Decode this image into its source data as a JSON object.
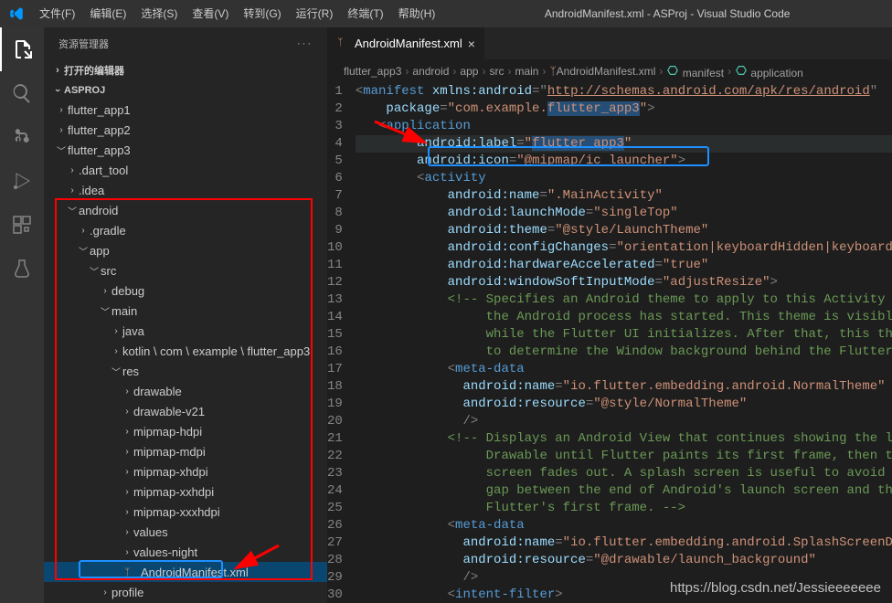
{
  "window_title": "AndroidManifest.xml - ASProj - Visual Studio Code",
  "menu": [
    "文件(F)",
    "编辑(E)",
    "选择(S)",
    "查看(V)",
    "转到(G)",
    "运行(R)",
    "终端(T)",
    "帮助(H)"
  ],
  "sidebar": {
    "title": "资源管理器",
    "sections": {
      "open_editors": "打开的编辑器",
      "project": "ASPROJ"
    },
    "tree": [
      {
        "d": 1,
        "k": "folder-c",
        "label": "flutter_app1"
      },
      {
        "d": 1,
        "k": "folder-c",
        "label": "flutter_app2"
      },
      {
        "d": 1,
        "k": "folder-o",
        "label": "flutter_app3"
      },
      {
        "d": 2,
        "k": "folder-c",
        "label": ".dart_tool"
      },
      {
        "d": 2,
        "k": "folder-c",
        "label": ".idea"
      },
      {
        "d": 2,
        "k": "folder-o",
        "label": "android"
      },
      {
        "d": 3,
        "k": "folder-c",
        "label": ".gradle"
      },
      {
        "d": 3,
        "k": "folder-o",
        "label": "app"
      },
      {
        "d": 4,
        "k": "folder-o",
        "label": "src"
      },
      {
        "d": 5,
        "k": "folder-c",
        "label": "debug"
      },
      {
        "d": 5,
        "k": "folder-o",
        "label": "main"
      },
      {
        "d": 6,
        "k": "folder-c",
        "label": "java"
      },
      {
        "d": 6,
        "k": "folder-c",
        "label": "kotlin \\ com \\ example \\ flutter_app3"
      },
      {
        "d": 6,
        "k": "folder-o",
        "label": "res"
      },
      {
        "d": 7,
        "k": "folder-c",
        "label": "drawable"
      },
      {
        "d": 7,
        "k": "folder-c",
        "label": "drawable-v21"
      },
      {
        "d": 7,
        "k": "folder-c",
        "label": "mipmap-hdpi"
      },
      {
        "d": 7,
        "k": "folder-c",
        "label": "mipmap-mdpi"
      },
      {
        "d": 7,
        "k": "folder-c",
        "label": "mipmap-xhdpi"
      },
      {
        "d": 7,
        "k": "folder-c",
        "label": "mipmap-xxhdpi"
      },
      {
        "d": 7,
        "k": "folder-c",
        "label": "mipmap-xxxhdpi"
      },
      {
        "d": 7,
        "k": "folder-c",
        "label": "values"
      },
      {
        "d": 7,
        "k": "folder-c",
        "label": "values-night"
      },
      {
        "d": 6,
        "k": "file-xml",
        "label": "AndroidManifest.xml",
        "selected": true
      },
      {
        "d": 5,
        "k": "folder-c",
        "label": "profile"
      }
    ]
  },
  "tab": {
    "label": "AndroidManifest.xml"
  },
  "breadcrumbs": [
    "flutter_app3",
    "android",
    "app",
    "src",
    "main",
    "AndroidManifest.xml",
    "manifest",
    "application"
  ],
  "code": {
    "lines": [
      {
        "n": 1,
        "seg": [
          [
            "p",
            "<"
          ],
          [
            "t",
            "manifest"
          ],
          [
            "p",
            " "
          ],
          [
            "a",
            "xmlns:android"
          ],
          [
            "p",
            "="
          ],
          [
            "p",
            "\""
          ],
          [
            "u",
            "http://schemas.android.com/apk/res/android"
          ],
          [
            "p",
            "\""
          ]
        ]
      },
      {
        "n": 2,
        "seg": [
          [
            "sp",
            "    "
          ],
          [
            "a",
            "package"
          ],
          [
            "p",
            "="
          ],
          [
            "s",
            "\"com.example."
          ],
          [
            "ssel",
            "flutter_app3"
          ],
          [
            "s",
            "\""
          ],
          [
            "p",
            ">"
          ]
        ]
      },
      {
        "n": 3,
        "seg": [
          [
            "sp",
            "   "
          ],
          [
            "p",
            "<"
          ],
          [
            "t",
            "application"
          ]
        ]
      },
      {
        "n": 4,
        "seg": [
          [
            "sp",
            "        "
          ],
          [
            "a",
            "android:label"
          ],
          [
            "p",
            "="
          ],
          [
            "s",
            "\""
          ],
          [
            "ssel",
            "flutter_app3"
          ],
          [
            "s",
            "\""
          ]
        ],
        "hl": true
      },
      {
        "n": 5,
        "seg": [
          [
            "sp",
            "        "
          ],
          [
            "a",
            "android:icon"
          ],
          [
            "p",
            "="
          ],
          [
            "s",
            "\"@mipmap/ic_launcher\""
          ],
          [
            "p",
            ">"
          ]
        ]
      },
      {
        "n": 6,
        "seg": [
          [
            "sp",
            "        "
          ],
          [
            "p",
            "<"
          ],
          [
            "t",
            "activity"
          ]
        ]
      },
      {
        "n": 7,
        "seg": [
          [
            "sp",
            "            "
          ],
          [
            "a",
            "android:name"
          ],
          [
            "p",
            "="
          ],
          [
            "s",
            "\".MainActivity\""
          ]
        ]
      },
      {
        "n": 8,
        "seg": [
          [
            "sp",
            "            "
          ],
          [
            "a",
            "android:launchMode"
          ],
          [
            "p",
            "="
          ],
          [
            "s",
            "\"singleTop\""
          ]
        ]
      },
      {
        "n": 9,
        "seg": [
          [
            "sp",
            "            "
          ],
          [
            "a",
            "android:theme"
          ],
          [
            "p",
            "="
          ],
          [
            "s",
            "\"@style/LaunchTheme\""
          ]
        ]
      },
      {
        "n": 10,
        "seg": [
          [
            "sp",
            "            "
          ],
          [
            "a",
            "android:configChanges"
          ],
          [
            "p",
            "="
          ],
          [
            "s",
            "\"orientation|keyboardHidden|keyboard|sc"
          ]
        ]
      },
      {
        "n": 11,
        "seg": [
          [
            "sp",
            "            "
          ],
          [
            "a",
            "android:hardwareAccelerated"
          ],
          [
            "p",
            "="
          ],
          [
            "s",
            "\"true\""
          ]
        ]
      },
      {
        "n": 12,
        "seg": [
          [
            "sp",
            "            "
          ],
          [
            "a",
            "android:windowSoftInputMode"
          ],
          [
            "p",
            "="
          ],
          [
            "s",
            "\"adjustResize\""
          ],
          [
            "p",
            ">"
          ]
        ]
      },
      {
        "n": 13,
        "seg": [
          [
            "sp",
            "            "
          ],
          [
            "c",
            "<!-- Specifies an Android theme to apply to this Activity as "
          ]
        ]
      },
      {
        "n": 14,
        "seg": [
          [
            "sp",
            "                 "
          ],
          [
            "c",
            "the Android process has started. This theme is visible t"
          ]
        ]
      },
      {
        "n": 15,
        "seg": [
          [
            "sp",
            "                 "
          ],
          [
            "c",
            "while the Flutter UI initializes. After that, this theme"
          ]
        ]
      },
      {
        "n": 16,
        "seg": [
          [
            "sp",
            "                 "
          ],
          [
            "c",
            "to determine the Window background behind the Flutter UI"
          ]
        ]
      },
      {
        "n": 17,
        "seg": [
          [
            "sp",
            "            "
          ],
          [
            "p",
            "<"
          ],
          [
            "t",
            "meta-data"
          ]
        ]
      },
      {
        "n": 18,
        "seg": [
          [
            "sp",
            "              "
          ],
          [
            "a",
            "android:name"
          ],
          [
            "p",
            "="
          ],
          [
            "s",
            "\"io.flutter.embedding.android.NormalTheme\""
          ]
        ]
      },
      {
        "n": 19,
        "seg": [
          [
            "sp",
            "              "
          ],
          [
            "a",
            "android:resource"
          ],
          [
            "p",
            "="
          ],
          [
            "s",
            "\"@style/NormalTheme\""
          ]
        ]
      },
      {
        "n": 20,
        "seg": [
          [
            "sp",
            "              "
          ],
          [
            "p",
            "/>"
          ]
        ]
      },
      {
        "n": 21,
        "seg": [
          [
            "sp",
            "            "
          ],
          [
            "c",
            "<!-- Displays an Android View that continues showing the laur"
          ]
        ]
      },
      {
        "n": 22,
        "seg": [
          [
            "sp",
            "                 "
          ],
          [
            "c",
            "Drawable until Flutter paints its first frame, then this"
          ]
        ]
      },
      {
        "n": 23,
        "seg": [
          [
            "sp",
            "                 "
          ],
          [
            "c",
            "screen fades out. A splash screen is useful to avoid any"
          ]
        ]
      },
      {
        "n": 24,
        "seg": [
          [
            "sp",
            "                 "
          ],
          [
            "c",
            "gap between the end of Android's launch screen and the p"
          ]
        ]
      },
      {
        "n": 25,
        "seg": [
          [
            "sp",
            "                 "
          ],
          [
            "c",
            "Flutter's first frame. -->"
          ]
        ]
      },
      {
        "n": 26,
        "seg": [
          [
            "sp",
            "            "
          ],
          [
            "p",
            "<"
          ],
          [
            "t",
            "meta-data"
          ]
        ]
      },
      {
        "n": 27,
        "seg": [
          [
            "sp",
            "              "
          ],
          [
            "a",
            "android:name"
          ],
          [
            "p",
            "="
          ],
          [
            "s",
            "\"io.flutter.embedding.android.SplashScreenDraw"
          ]
        ]
      },
      {
        "n": 28,
        "seg": [
          [
            "sp",
            "              "
          ],
          [
            "a",
            "android:resource"
          ],
          [
            "p",
            "="
          ],
          [
            "s",
            "\"@drawable/launch_background\""
          ]
        ]
      },
      {
        "n": 29,
        "seg": [
          [
            "sp",
            "              "
          ],
          [
            "p",
            "/>"
          ]
        ]
      },
      {
        "n": 30,
        "seg": [
          [
            "sp",
            "            "
          ],
          [
            "p",
            "<"
          ],
          [
            "t",
            "intent-filter"
          ],
          [
            "p",
            ">"
          ]
        ]
      }
    ]
  },
  "watermark": "https://blog.csdn.net/Jessieeeeeee"
}
